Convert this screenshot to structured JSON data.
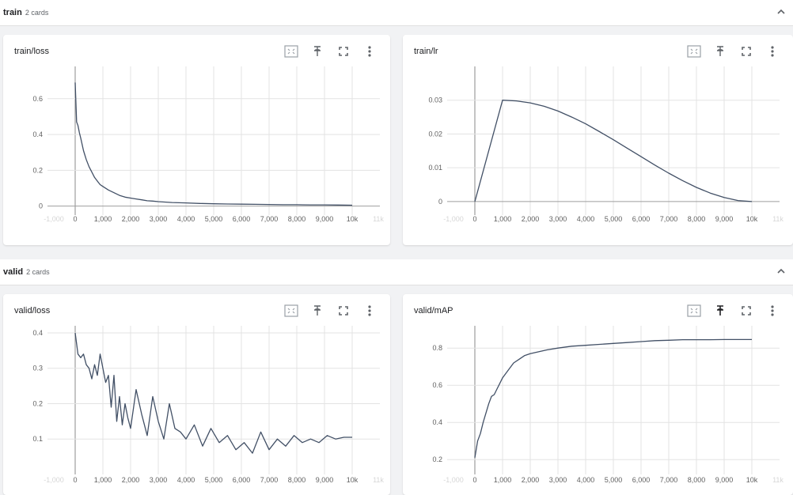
{
  "groups": [
    {
      "name": "train",
      "count_label": "2 cards"
    },
    {
      "name": "valid",
      "count_label": "2 cards"
    }
  ],
  "colors": {
    "line": "#425066",
    "grid": "#e3e3e3",
    "tick": "#616161",
    "axis": "#9e9e9e"
  },
  "icons": [
    "fit-domain-icon",
    "pin-icon",
    "fullscreen-icon",
    "more-vert-icon"
  ],
  "chart_data": [
    {
      "id": "train-loss",
      "title": "train/loss",
      "type": "line",
      "x_ticks": [
        "0",
        "1,000",
        "2,000",
        "3,000",
        "4,000",
        "5,000",
        "6,000",
        "7,000",
        "8,000",
        "9,000",
        "10k"
      ],
      "x_ticks_faint": {
        "left": "-1,000",
        "right": "11k"
      },
      "y_ticks": [
        0,
        0.2,
        0.4,
        0.6
      ],
      "y_range": [
        -0.05,
        0.78
      ],
      "x_range": [
        -1000,
        11000
      ],
      "x": [
        0,
        50,
        100,
        150,
        200,
        300,
        400,
        500,
        600,
        700,
        800,
        900,
        1000,
        1200,
        1400,
        1600,
        1800,
        2000,
        2200,
        2400,
        2600,
        2800,
        3000,
        3500,
        4000,
        4500,
        5000,
        5500,
        6000,
        6500,
        7000,
        7500,
        8000,
        8500,
        9000,
        9500,
        10000
      ],
      "y": [
        0.69,
        0.47,
        0.45,
        0.41,
        0.38,
        0.31,
        0.26,
        0.22,
        0.19,
        0.16,
        0.14,
        0.12,
        0.11,
        0.09,
        0.075,
        0.06,
        0.05,
        0.045,
        0.04,
        0.035,
        0.03,
        0.028,
        0.025,
        0.02,
        0.018,
        0.015,
        0.013,
        0.012,
        0.011,
        0.01,
        0.009,
        0.008,
        0.008,
        0.007,
        0.007,
        0.006,
        0.005
      ]
    },
    {
      "id": "train-lr",
      "title": "train/lr",
      "type": "line",
      "x_ticks": [
        "0",
        "1,000",
        "2,000",
        "3,000",
        "4,000",
        "5,000",
        "6,000",
        "7,000",
        "8,000",
        "9,000",
        "10k"
      ],
      "x_ticks_faint": {
        "left": "-1,000",
        "right": "11k"
      },
      "y_ticks": [
        0,
        0.01,
        0.02,
        0.03
      ],
      "y_range": [
        -0.004,
        0.04
      ],
      "x_range": [
        -1000,
        11000
      ],
      "x": [
        0,
        1000,
        1500,
        2000,
        2500,
        3000,
        3500,
        4000,
        4500,
        5000,
        5500,
        6000,
        6500,
        7000,
        7500,
        8000,
        8500,
        9000,
        9500,
        10000
      ],
      "y": [
        0,
        0.03,
        0.0298,
        0.0292,
        0.0282,
        0.0268,
        0.025,
        0.023,
        0.0207,
        0.0183,
        0.0158,
        0.0133,
        0.0108,
        0.0084,
        0.0062,
        0.0042,
        0.0025,
        0.0012,
        0.0003,
        0
      ]
    },
    {
      "id": "valid-loss",
      "title": "valid/loss",
      "type": "line",
      "x_ticks": [
        "0",
        "1,000",
        "2,000",
        "3,000",
        "4,000",
        "5,000",
        "6,000",
        "7,000",
        "8,000",
        "9,000",
        "10k"
      ],
      "x_ticks_faint": {
        "left": "-1,000",
        "right": "11k"
      },
      "y_ticks": [
        0.1,
        0.2,
        0.3,
        0.4
      ],
      "y_range": [
        0.0,
        0.42
      ],
      "x_range": [
        -1000,
        11000
      ],
      "x": [
        0,
        100,
        200,
        300,
        400,
        500,
        600,
        700,
        800,
        900,
        1000,
        1100,
        1200,
        1300,
        1400,
        1500,
        1600,
        1700,
        1800,
        1900,
        2000,
        2200,
        2400,
        2600,
        2800,
        3000,
        3200,
        3400,
        3600,
        3800,
        4000,
        4300,
        4600,
        4900,
        5200,
        5500,
        5800,
        6100,
        6400,
        6700,
        7000,
        7300,
        7600,
        7900,
        8200,
        8500,
        8800,
        9100,
        9400,
        9700,
        10000
      ],
      "y": [
        0.4,
        0.34,
        0.33,
        0.34,
        0.31,
        0.3,
        0.27,
        0.31,
        0.28,
        0.34,
        0.3,
        0.26,
        0.28,
        0.19,
        0.28,
        0.15,
        0.22,
        0.14,
        0.2,
        0.16,
        0.13,
        0.24,
        0.17,
        0.11,
        0.22,
        0.15,
        0.1,
        0.2,
        0.13,
        0.12,
        0.1,
        0.14,
        0.08,
        0.13,
        0.09,
        0.11,
        0.07,
        0.09,
        0.06,
        0.12,
        0.07,
        0.1,
        0.08,
        0.11,
        0.09,
        0.1,
        0.09,
        0.11,
        0.1,
        0.105,
        0.105
      ]
    },
    {
      "id": "valid-map",
      "title": "valid/mAP",
      "type": "line",
      "x_ticks": [
        "0",
        "1,000",
        "2,000",
        "3,000",
        "4,000",
        "5,000",
        "6,000",
        "7,000",
        "8,000",
        "9,000",
        "10k"
      ],
      "x_ticks_faint": {
        "left": "-1,000",
        "right": "11k"
      },
      "y_ticks": [
        0.2,
        0.4,
        0.6,
        0.8
      ],
      "y_range": [
        0.12,
        0.92
      ],
      "x_range": [
        -1000,
        11000
      ],
      "x": [
        0,
        100,
        200,
        300,
        400,
        500,
        600,
        700,
        800,
        900,
        1000,
        1200,
        1400,
        1600,
        1800,
        2000,
        2300,
        2600,
        3000,
        3500,
        4000,
        4500,
        5000,
        5500,
        6000,
        6500,
        7000,
        7500,
        8000,
        8500,
        9000,
        9500,
        10000
      ],
      "y": [
        0.21,
        0.3,
        0.34,
        0.4,
        0.45,
        0.5,
        0.54,
        0.55,
        0.58,
        0.61,
        0.64,
        0.68,
        0.72,
        0.74,
        0.76,
        0.77,
        0.78,
        0.79,
        0.8,
        0.81,
        0.815,
        0.82,
        0.825,
        0.83,
        0.835,
        0.84,
        0.842,
        0.845,
        0.845,
        0.845,
        0.846,
        0.846,
        0.846
      ]
    }
  ]
}
